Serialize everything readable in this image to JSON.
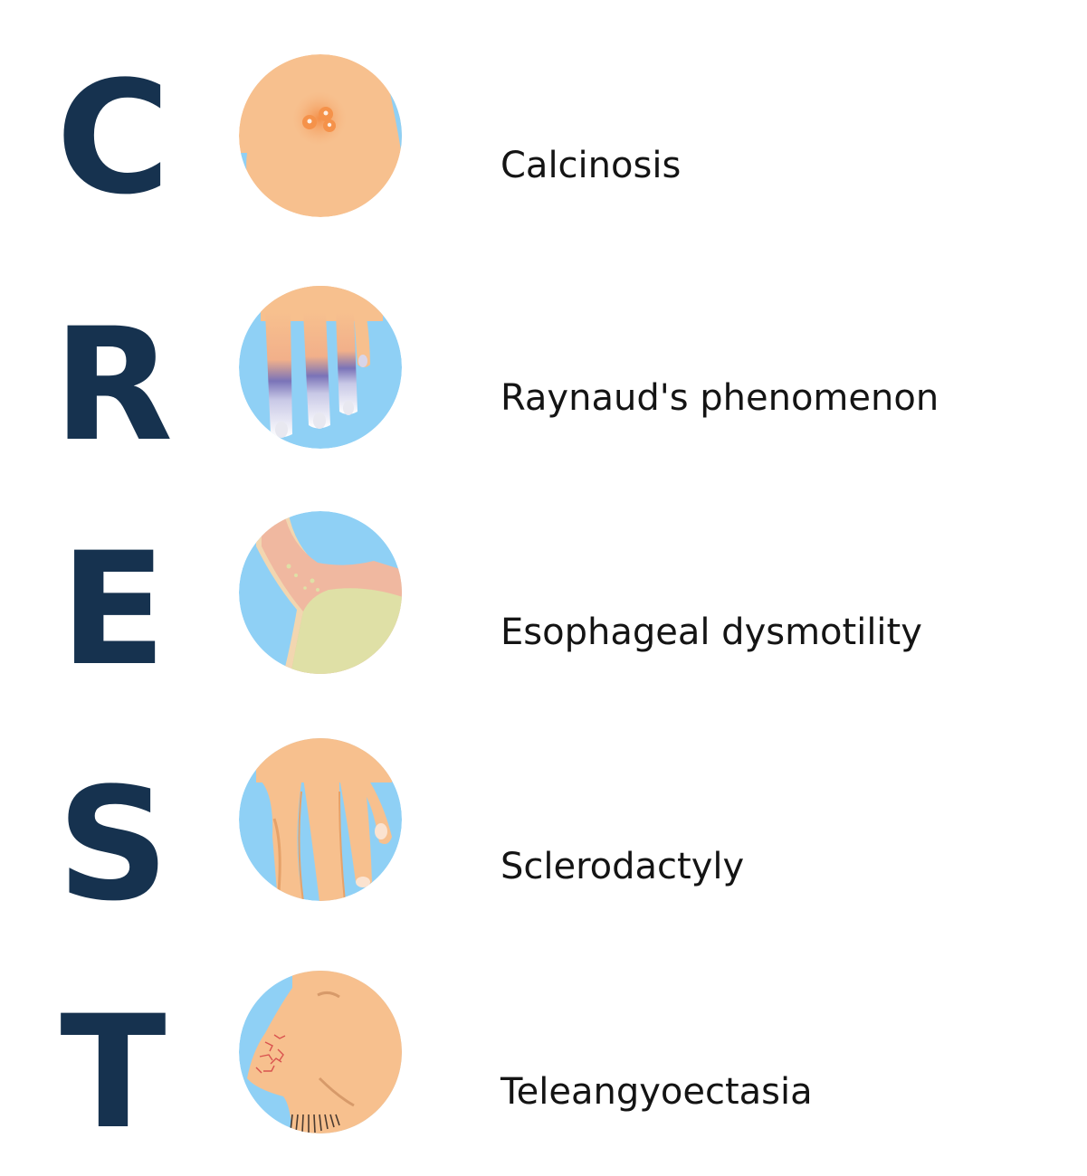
{
  "rows": [
    {
      "letter": "C",
      "term": "Calcinosis",
      "icon": "calcinosis-skin-icon"
    },
    {
      "letter": "R",
      "term": "Raynaud's phenomenon",
      "icon": "raynaud-fingers-icon"
    },
    {
      "letter": "E",
      "term": "Esophageal dysmotility",
      "icon": "esophagus-stomach-icon"
    },
    {
      "letter": "S",
      "term": "Sclerodactyly",
      "icon": "sclerodactyly-hand-icon"
    },
    {
      "letter": "T",
      "term": "Teleangyoectasia",
      "icon": "telangiectasia-face-icon"
    }
  ],
  "colors": {
    "letter": "#16324f",
    "skin": "#f7c08e",
    "background_circle": "#8fd0f5",
    "stomach": "#dfe0a6",
    "text": "#141414"
  }
}
